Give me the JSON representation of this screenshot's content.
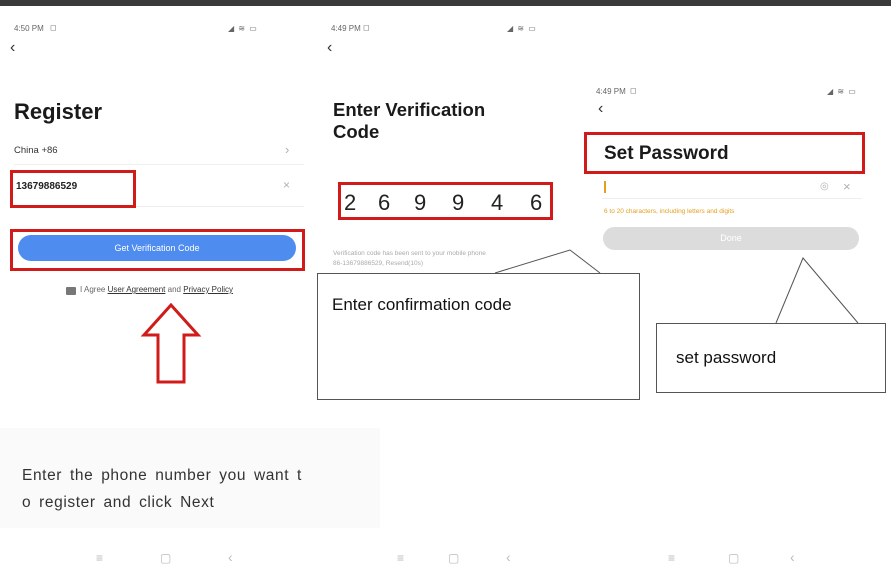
{
  "register": {
    "time": "4:50 PM",
    "title": "Register",
    "country": "China +86",
    "phone": "13679886529",
    "button": "Get Verification Code",
    "agree_prefix": "I Agree",
    "user_agreement": "User Agreement",
    "and": "and",
    "privacy_policy": "Privacy Policy"
  },
  "verify": {
    "time": "4:49 PM",
    "title_line1": "Enter Verification",
    "title_line2": "Code",
    "digits": [
      "2",
      "6",
      "9",
      "9",
      "4",
      "6"
    ],
    "hint_line1": "Verification code has been sent to your mobile phone",
    "hint_line2": "86-13679886529, Resend(10s)"
  },
  "password": {
    "time": "4:49 PM",
    "title": "Set Password",
    "rule": "6 to 20 characters, including letters and digits",
    "button": "Done"
  },
  "annotations": {
    "confirm_callout": "Enter confirmation code",
    "password_callout": "set password",
    "caption_line1": "Enter the phone number you want t",
    "caption_line2": "o register and click Next"
  },
  "nav": {
    "menu": "≡",
    "home": "▢",
    "back": "‹"
  },
  "icons": {
    "back": "‹",
    "chevron": "›",
    "clear": "×",
    "eye": "◎"
  },
  "colors": {
    "accent": "#4f8cf0",
    "annotation": "#d11a1a",
    "warning": "#e0a020"
  }
}
